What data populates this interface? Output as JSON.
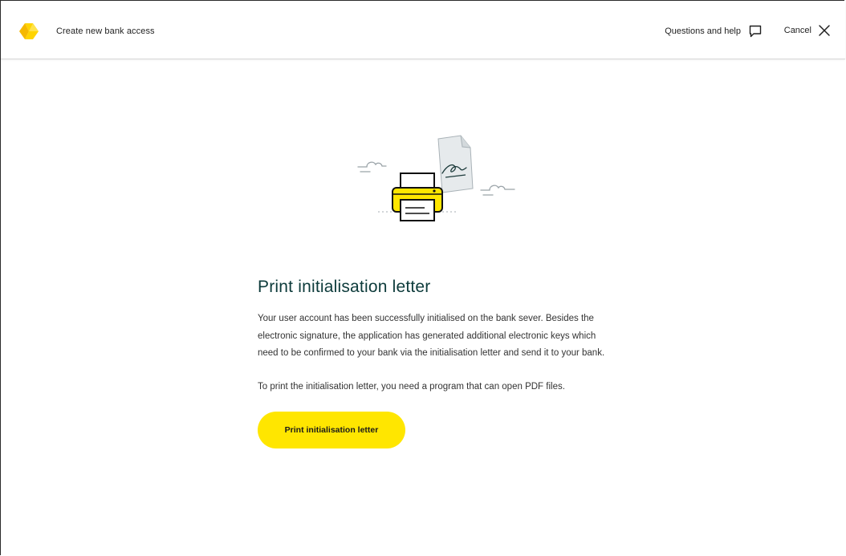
{
  "header": {
    "title": "Create new bank access",
    "help_label": "Questions and help",
    "cancel_label": "Cancel",
    "logo_icon": "commerzbank-ribbon-logo",
    "help_icon": "speech-bubble-icon",
    "cancel_icon": "close-icon"
  },
  "main": {
    "illustration": "printer-with-signed-document-illustration",
    "title": "Print initialisation letter",
    "paragraphs": [
      "Your user account has been successfully initialised on the bank sever. Besides the electronic signature, the application has generated additional electronic keys which need to be confirmed to your bank via the initialisation letter and send it to your bank.",
      "To print the initialisation letter, you need a program that can open PDF files."
    ],
    "print_button_label": "Print initialisation letter"
  },
  "colors": {
    "accent_yellow": "#ffe600",
    "title_color": "#0d3b3b",
    "text_color": "#333333"
  }
}
